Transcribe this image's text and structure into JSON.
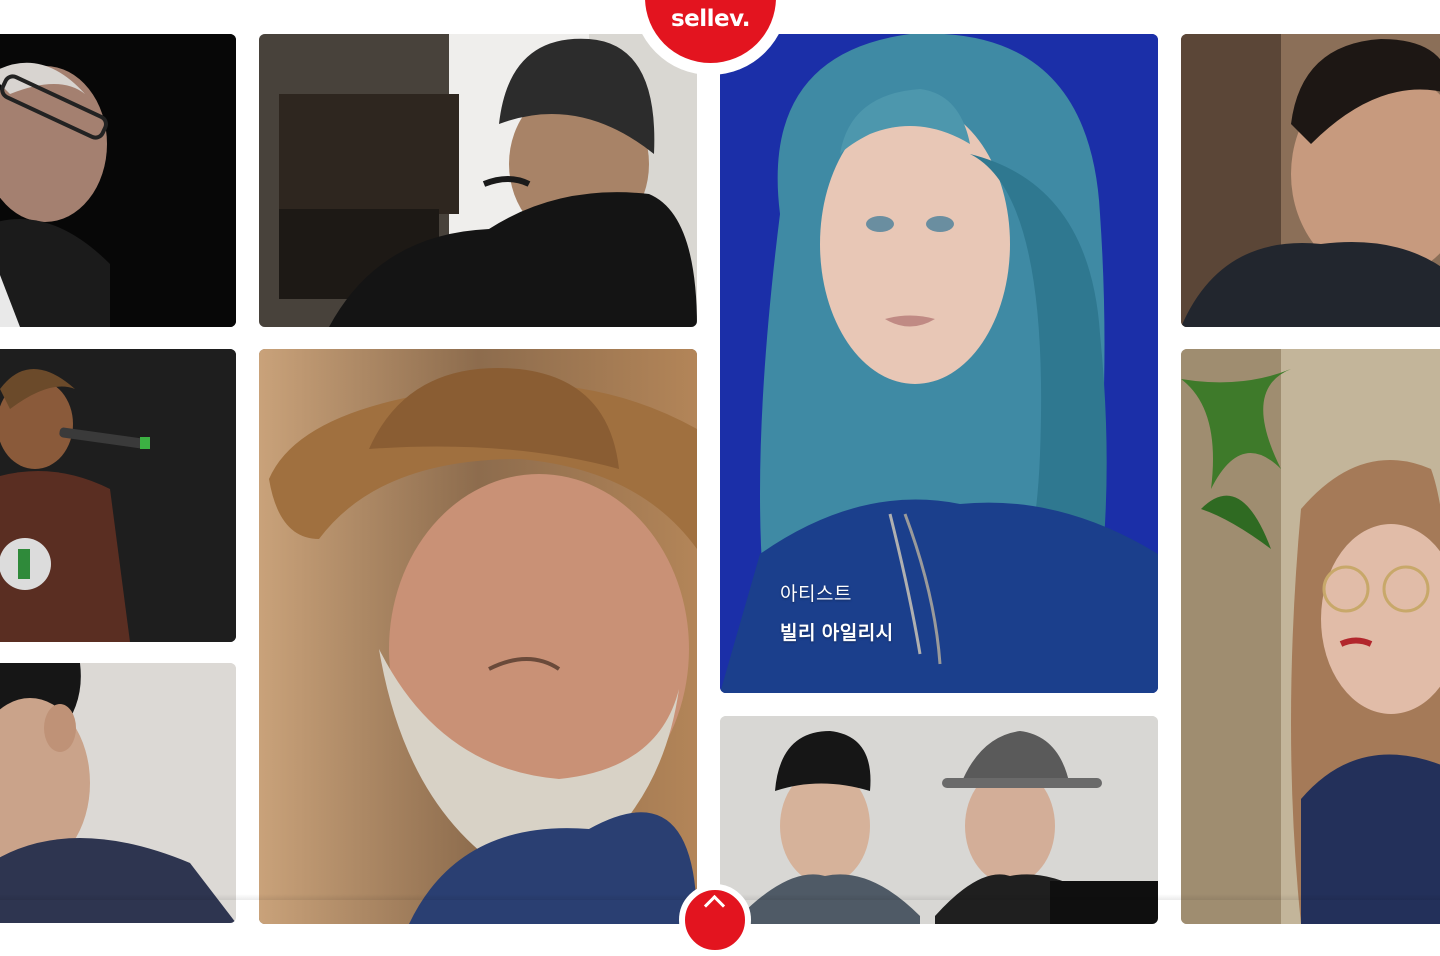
{
  "brand": {
    "logo_text": "sellev.",
    "accent": "#e3141f"
  },
  "featured": {
    "category": "아티스트",
    "name": "빌리 아일리시"
  },
  "cards": [
    {
      "id": "elder-pianist",
      "icon": "portrait-photo"
    },
    {
      "id": "beanie-man",
      "icon": "portrait-photo"
    },
    {
      "id": "billie-eilish",
      "icon": "portrait-photo"
    },
    {
      "id": "young-man-right",
      "icon": "portrait-photo"
    },
    {
      "id": "singer-microphone",
      "icon": "portrait-photo"
    },
    {
      "id": "straw-hat-man",
      "icon": "portrait-photo"
    },
    {
      "id": "boy-profile",
      "icon": "portrait-photo"
    },
    {
      "id": "two-hat-guys",
      "icon": "portrait-photo"
    },
    {
      "id": "woman-glasses",
      "icon": "portrait-photo"
    }
  ]
}
